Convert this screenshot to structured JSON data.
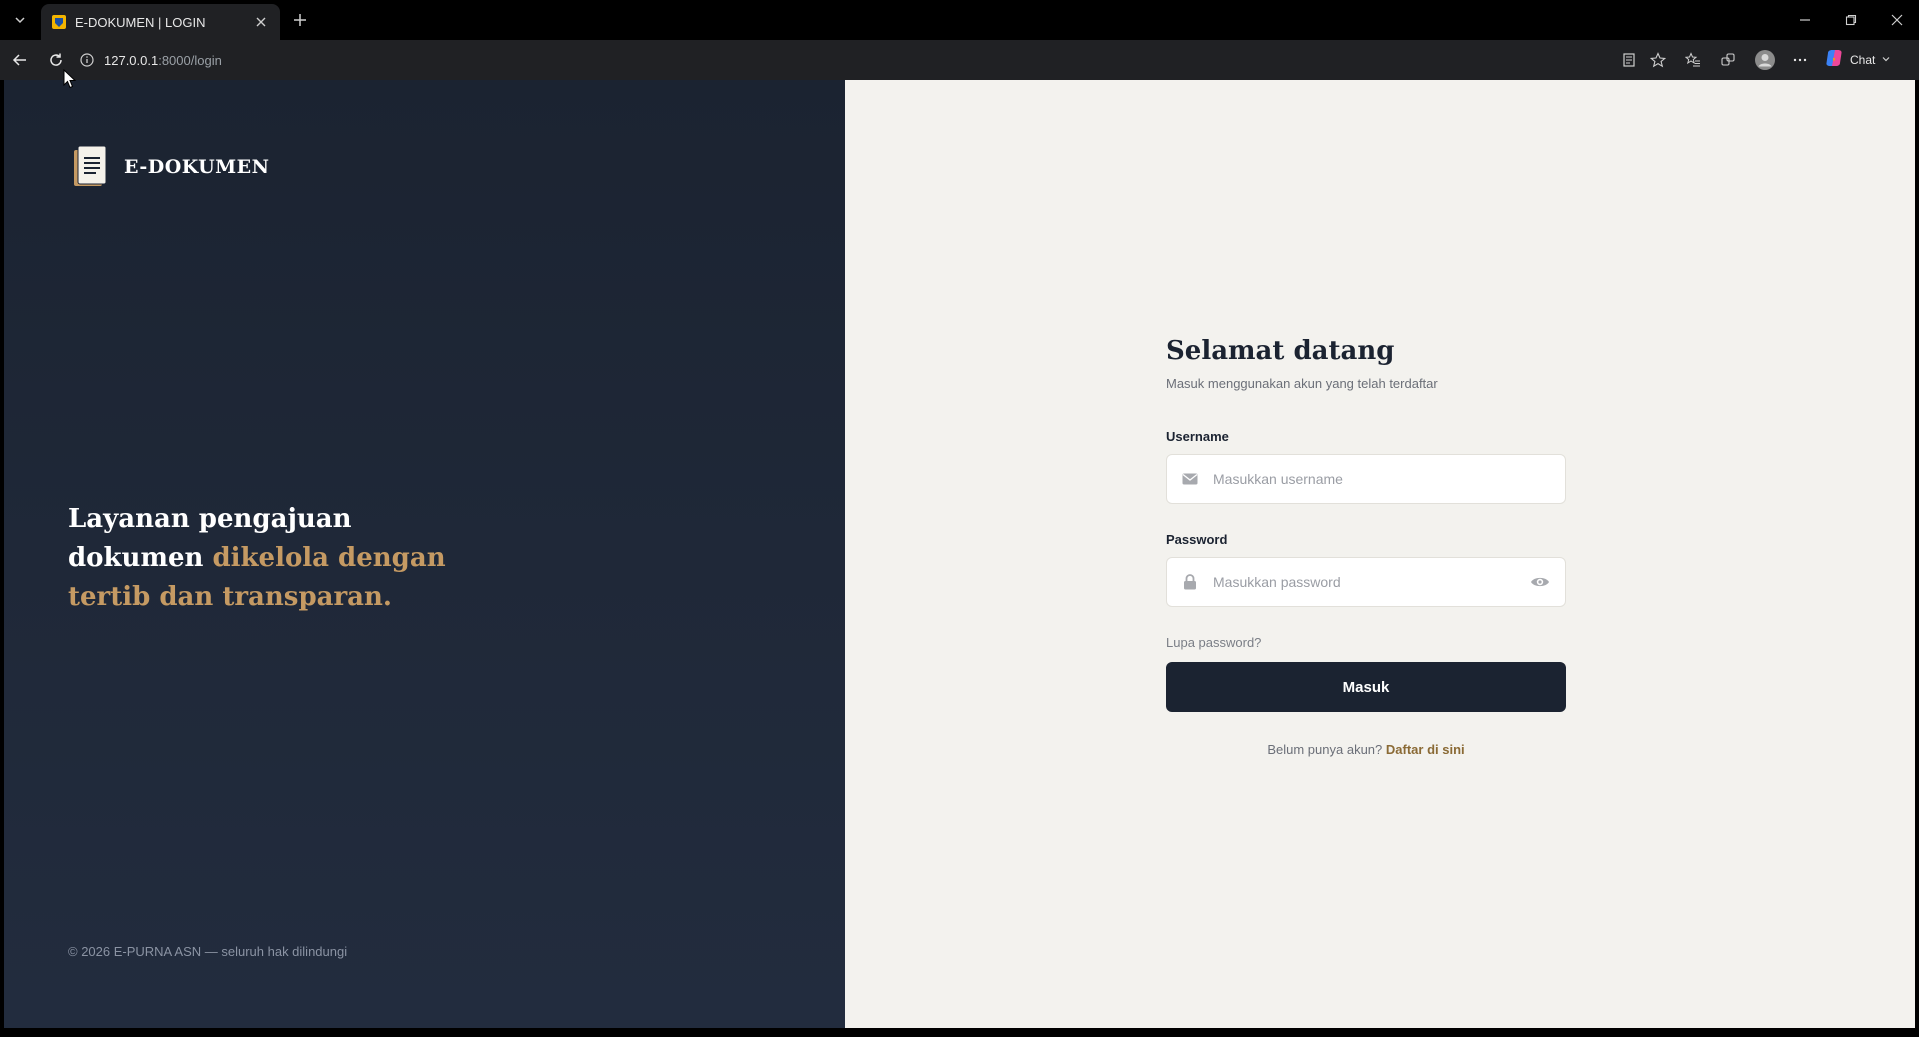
{
  "browser": {
    "tab_title": "E-DOKUMEN | LOGIN",
    "url_host": "127.0.0.1",
    "url_path": ":8000/login",
    "chat_label": "Chat"
  },
  "brand": {
    "name": "E-DOKUMEN"
  },
  "tagline": {
    "part1": "Layanan pengajuan dokumen ",
    "part2": "dikelola dengan tertib dan transparan."
  },
  "footer": {
    "copyright": "© 2026 E-PURNA ASN — seluruh hak dilindungi"
  },
  "login": {
    "title": "Selamat datang",
    "subtitle": "Masuk menggunakan akun yang telah terdaftar",
    "username_label": "Username",
    "username_placeholder": "Masukkan username",
    "password_label": "Password",
    "password_placeholder": "Masukkan password",
    "forgot_link": "Lupa password?",
    "submit_label": "Masuk",
    "register_prompt": "Belum punya akun?",
    "register_link": "Daftar di sini"
  },
  "colors": {
    "dark_navy": "#1b2331",
    "accent_gold": "#c59a63",
    "link_brown": "#8a6a35",
    "page_bg": "#f3f2ee"
  }
}
